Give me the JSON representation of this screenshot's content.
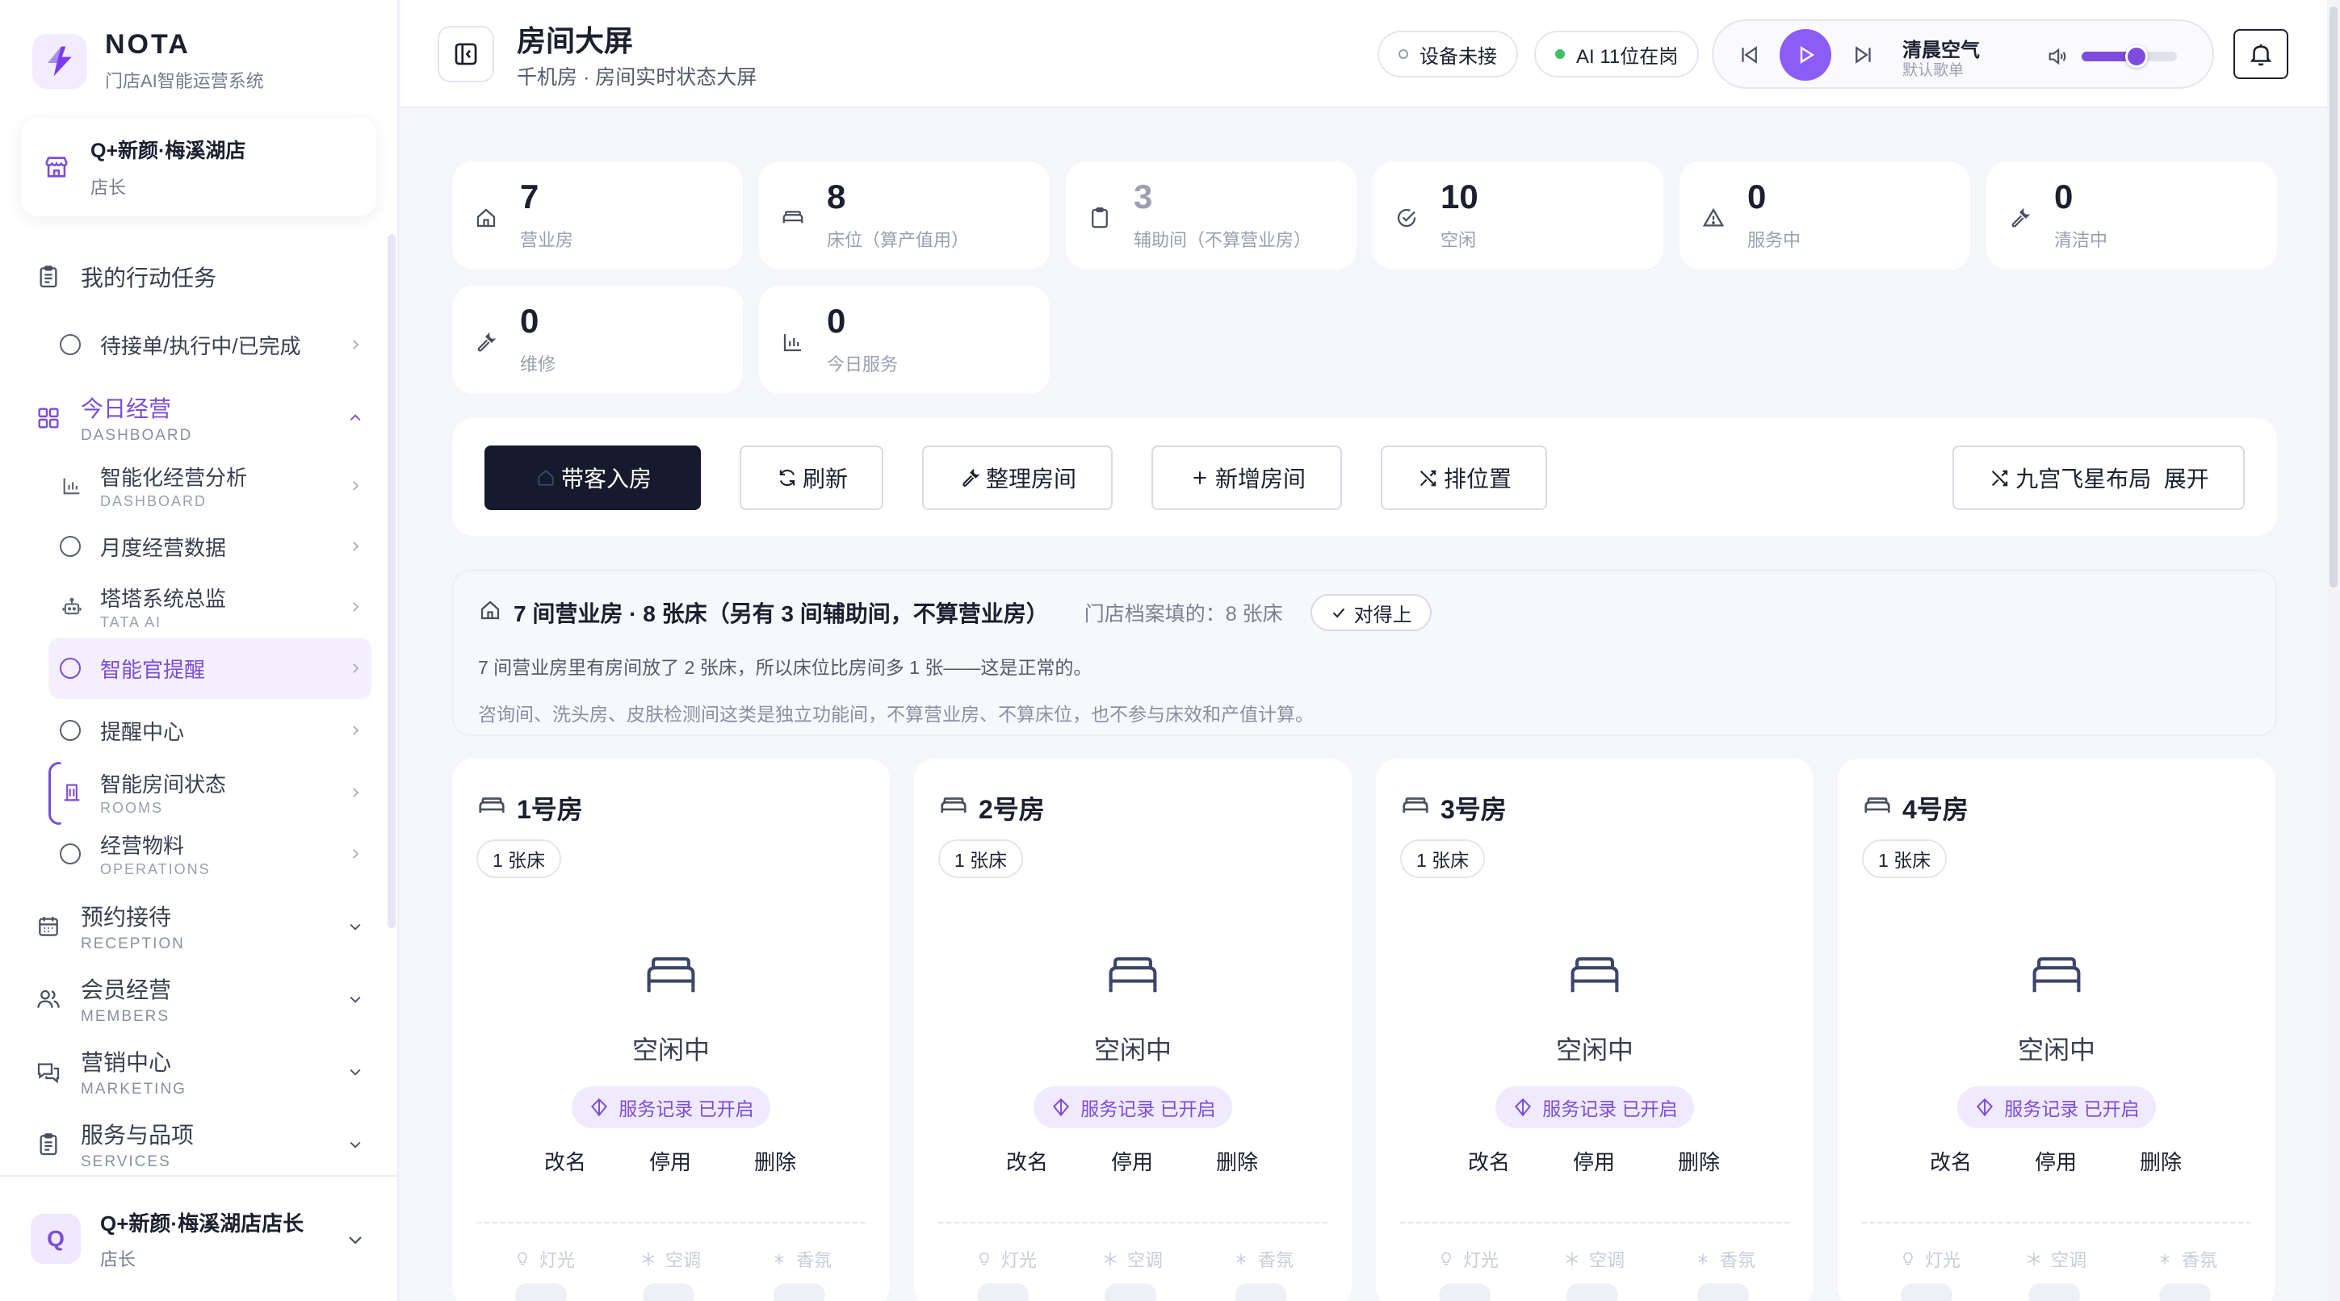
{
  "brand": {
    "name": "NOTA",
    "subtitle": "门店AI智能运营系统"
  },
  "store": {
    "name": "Q+新颜·梅溪湖店",
    "role": "店长"
  },
  "nav": {
    "tasks": {
      "label": "我的行动任务"
    },
    "tasks_sub": {
      "label": "待接单/执行中/已完成"
    },
    "dashboard": {
      "label": "今日经营",
      "label_en": "DASHBOARD"
    },
    "dash_items": [
      {
        "label": "智能化经营分析",
        "label_en": "DASHBOARD"
      },
      {
        "label": "月度经营数据",
        "label_en": ""
      },
      {
        "label": "塔塔系统总监",
        "label_en": "TATA AI"
      },
      {
        "label": "智能官提醒",
        "label_en": ""
      },
      {
        "label": "提醒中心",
        "label_en": ""
      },
      {
        "label": "智能房间状态",
        "label_en": "ROOMS"
      },
      {
        "label": "经营物料",
        "label_en": "OPERATIONS"
      }
    ],
    "reception": {
      "label": "预约接待",
      "label_en": "RECEPTION"
    },
    "members": {
      "label": "会员经营",
      "label_en": "MEMBERS"
    },
    "marketing": {
      "label": "营销中心",
      "label_en": "MARKETING"
    },
    "services": {
      "label": "服务与品项",
      "label_en": "SERVICES"
    }
  },
  "user": {
    "initial": "Q",
    "name": "Q+新颜·梅溪湖店店长",
    "role": "店长"
  },
  "header": {
    "title": "房间大屏",
    "subtitle": "千机房 · 房间实时状态大屏",
    "device_chip": "设备未接",
    "ai_chip": "AI 11位在岗"
  },
  "player": {
    "song": "清晨空气",
    "playlist": "默认歌单",
    "volume": 0.58
  },
  "stats": [
    {
      "value": "7",
      "label": "营业房"
    },
    {
      "value": "8",
      "label": "床位（算产值用）"
    },
    {
      "value": "3",
      "label": "辅助间（不算营业房）"
    },
    {
      "value": "10",
      "label": "空闲"
    },
    {
      "value": "0",
      "label": "服务中"
    },
    {
      "value": "0",
      "label": "清洁中"
    },
    {
      "value": "0",
      "label": "维修"
    },
    {
      "value": "0",
      "label": "今日服务"
    }
  ],
  "actions": {
    "check_in": "带客入房",
    "refresh": "刷新",
    "tidy": "整理房间",
    "add_room": "新增房间",
    "arrange": "排位置",
    "nine_palace": "九宫飞星布局  展开"
  },
  "info": {
    "title": "7 间营业房 · 8 张床（另有 3 间辅助间，不算营业房）",
    "archive": "门店档案填的：8 张床",
    "match": "对得上",
    "line2": "7 间营业房里有房间放了 2 张床，所以床位比房间多 1 张——这是正常的。",
    "line3": "咨询间、洗头房、皮肤检测间这类是独立功能间，不算营业房、不算床位，也不参与床效和产值计算。"
  },
  "rooms": [
    {
      "name": "1号房",
      "beds": "1 张床",
      "status": "空闲中",
      "record": "服务记录 已开启",
      "rename": "改名",
      "disable": "停用",
      "delete": "删除",
      "light": "灯光",
      "ac": "空调",
      "aroma": "香氛"
    },
    {
      "name": "2号房",
      "beds": "1 张床",
      "status": "空闲中",
      "record": "服务记录 已开启",
      "rename": "改名",
      "disable": "停用",
      "delete": "删除",
      "light": "灯光",
      "ac": "空调",
      "aroma": "香氛"
    },
    {
      "name": "3号房",
      "beds": "1 张床",
      "status": "空闲中",
      "record": "服务记录 已开启",
      "rename": "改名",
      "disable": "停用",
      "delete": "删除",
      "light": "灯光",
      "ac": "空调",
      "aroma": "香氛"
    },
    {
      "name": "4号房",
      "beds": "1 张床",
      "status": "空闲中",
      "record": "服务记录 已开启",
      "rename": "改名",
      "disable": "停用",
      "delete": "删除",
      "light": "灯光",
      "ac": "空调",
      "aroma": "香氛"
    }
  ],
  "colors": {
    "accent": "#7b4ddb",
    "primary_dark": "#151a2c",
    "ok_green": "#3fbf6a"
  }
}
